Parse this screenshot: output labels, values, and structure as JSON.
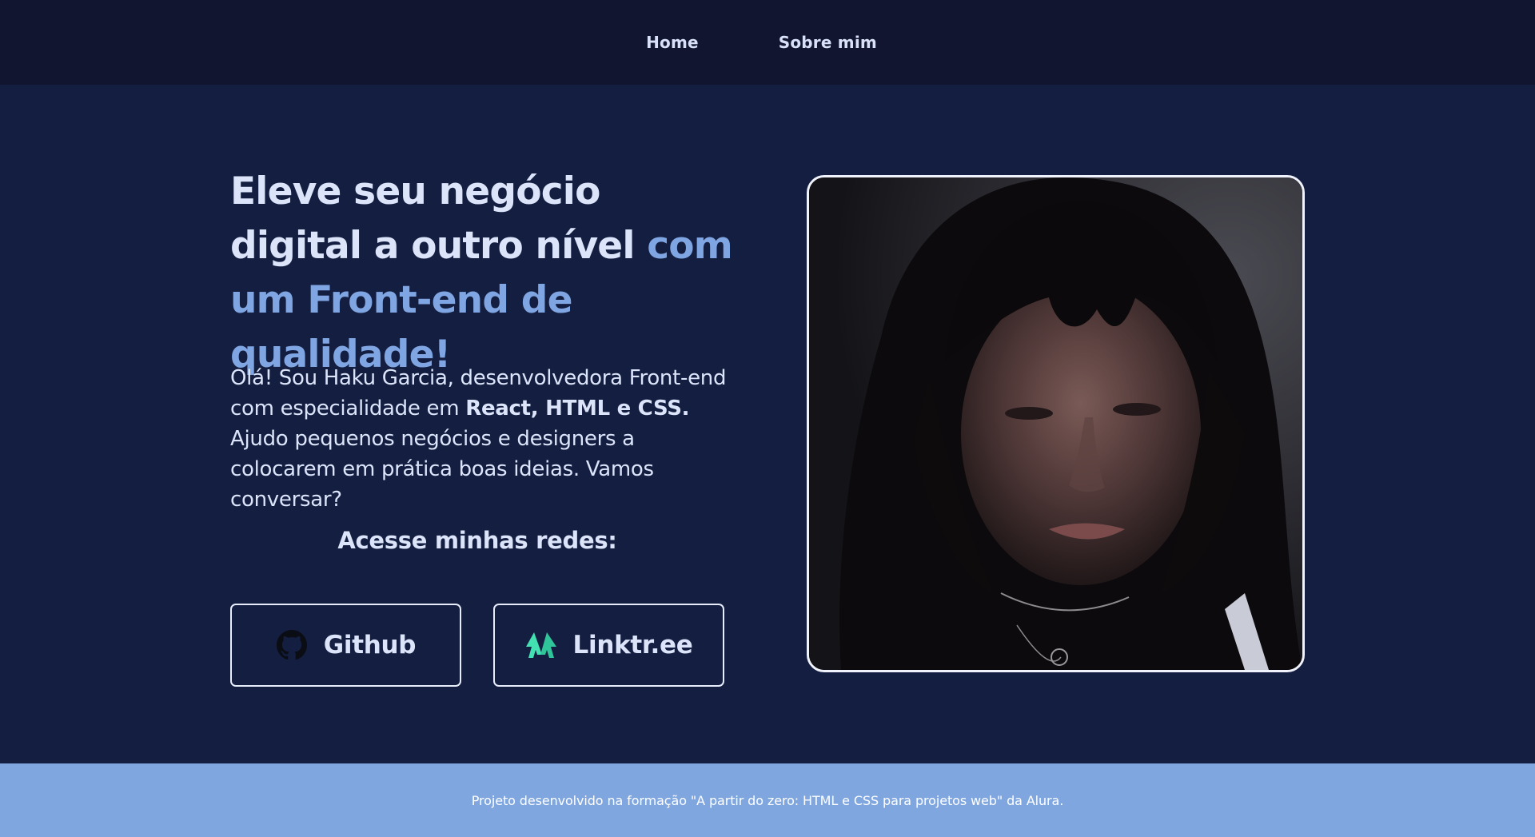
{
  "nav": {
    "items": [
      {
        "label": "Home"
      },
      {
        "label": "Sobre mim"
      }
    ]
  },
  "hero": {
    "headline_part1": "Eleve seu negócio digital a outro nível ",
    "headline_accent": "com um Front-end de qualidade!",
    "intro_part1": "Olá! Sou Haku Garcia, desenvolvedora Front-end com especialidade em ",
    "intro_bold": "React, HTML e CSS.",
    "intro_part2": " Ajudo pequenos negócios e designers a colocarem em prática boas ideias. Vamos conversar?",
    "social_title": "Acesse minhas redes:",
    "buttons": [
      {
        "label": "Github",
        "icon": "github-icon"
      },
      {
        "label": "Linktr.ee",
        "icon": "linktree-icon"
      }
    ],
    "photo_icon": "profile-photo"
  },
  "footer": {
    "text": "Projeto desenvolvido na formação \"A partir do zero: HTML e CSS para projetos web\" da Alura."
  },
  "colors": {
    "nav_bg": "#11152f",
    "page_bg": "#141e41",
    "text": "#dbe4f8",
    "accent": "#7fa6e2",
    "footer_bg": "#7fa6df",
    "linktree_icon": "#43e1b1"
  }
}
